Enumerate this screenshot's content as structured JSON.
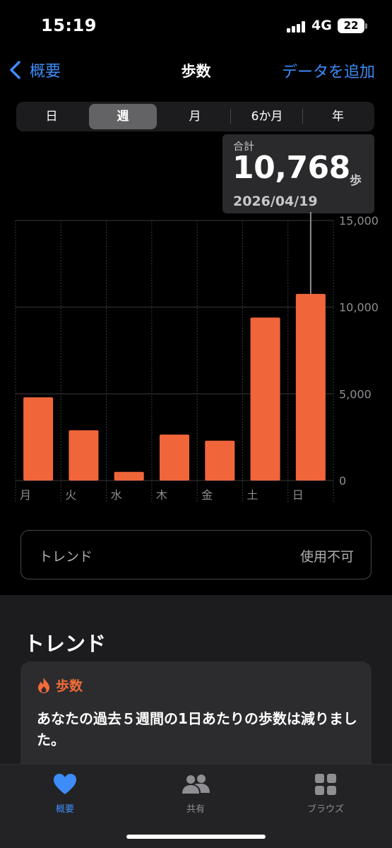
{
  "status": {
    "time": "15:19",
    "network": "4G",
    "battery": "22"
  },
  "nav": {
    "back_label": "概要",
    "title": "歩数",
    "add_label": "データを追加"
  },
  "segments": [
    "日",
    "週",
    "月",
    "6か月",
    "年"
  ],
  "active_segment": "週",
  "tooltip": {
    "label": "合計",
    "value": "10,768",
    "unit": "歩",
    "date": "2026/04/19"
  },
  "chart_data": {
    "type": "bar",
    "categories": [
      "月",
      "火",
      "水",
      "木",
      "金",
      "土",
      "日"
    ],
    "values": [
      4800,
      2900,
      500,
      2650,
      2300,
      9400,
      10768
    ],
    "ylim": [
      0,
      15000
    ],
    "yticks": [
      0,
      5000,
      10000,
      15000
    ],
    "ytick_labels": [
      "0",
      "5,000",
      "10,000",
      "15,000"
    ],
    "bar_color": "#f0663a",
    "highlight_index": 6,
    "grid": true
  },
  "trend_box": {
    "label": "トレンド",
    "value": "使用不可"
  },
  "trends": {
    "section_title": "トレンド",
    "card_title": "歩数",
    "card_text": "あなたの過去５週間の1日あたりの歩数は減りました。"
  },
  "tabs": [
    {
      "label": "概要",
      "icon": "heart-icon",
      "active": true
    },
    {
      "label": "共有",
      "icon": "people-icon",
      "active": false
    },
    {
      "label": "ブラウズ",
      "icon": "grid-icon",
      "active": false
    }
  ],
  "colors": {
    "accent": "#3e8cf7",
    "steps": "#f0663a",
    "background": "#000000"
  }
}
